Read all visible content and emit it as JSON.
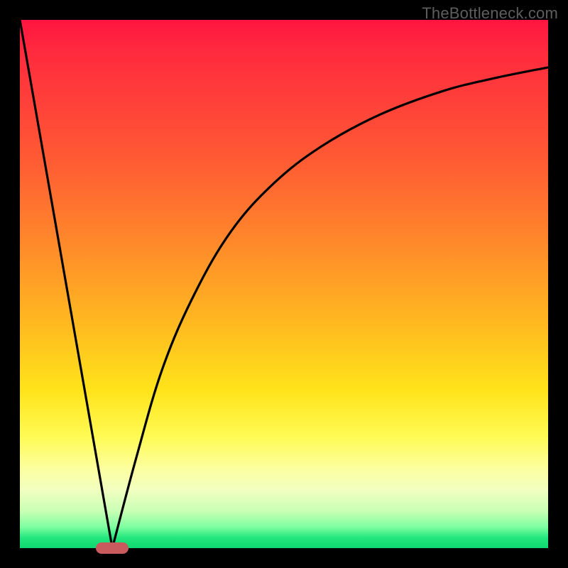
{
  "watermark": "TheBottleneck.com",
  "chart_data": {
    "type": "line",
    "title": "",
    "xlabel": "",
    "ylabel": "",
    "xlim": [
      0,
      100
    ],
    "ylim": [
      0,
      100
    ],
    "grid": false,
    "legend": false,
    "background_gradient": {
      "direction": "top_to_bottom",
      "stops": [
        {
          "pct": 0,
          "color": "#ff1540"
        },
        {
          "pct": 26,
          "color": "#ff5934"
        },
        {
          "pct": 43,
          "color": "#ff8b2a"
        },
        {
          "pct": 58,
          "color": "#ffbb20"
        },
        {
          "pct": 79,
          "color": "#fffb55"
        },
        {
          "pct": 93,
          "color": "#c9ffb5"
        },
        {
          "pct": 100,
          "color": "#0fd66f"
        }
      ]
    },
    "series": [
      {
        "name": "left-branch",
        "x": [
          0,
          17.5
        ],
        "values": [
          100,
          0
        ]
      },
      {
        "name": "right-branch",
        "x": [
          17.5,
          22,
          27,
          33,
          40,
          48,
          57,
          68,
          80,
          90,
          100
        ],
        "values": [
          0,
          17,
          34,
          48,
          60,
          69,
          76,
          82,
          86.5,
          89,
          91
        ]
      }
    ],
    "marker": {
      "x": 17.5,
      "y": 0,
      "shape": "rounded-rect",
      "color": "#c95b5e"
    }
  }
}
